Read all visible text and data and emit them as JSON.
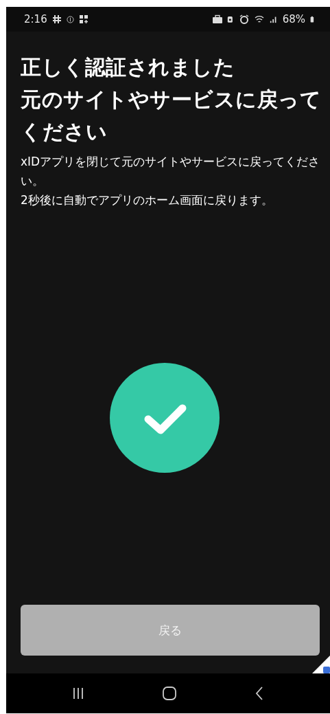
{
  "status_bar": {
    "time": "2:16",
    "battery": "68%"
  },
  "title": [
    "正しく認証されました",
    "元のサイトやサービスに戻ってください"
  ],
  "message": [
    "xIDアプリを閉じて元のサイトやサービスに戻ってください。",
    "2秒後に自動でアプリのホーム画面に戻ります。"
  ],
  "button": {
    "label": "戻る",
    "disabled": true
  }
}
